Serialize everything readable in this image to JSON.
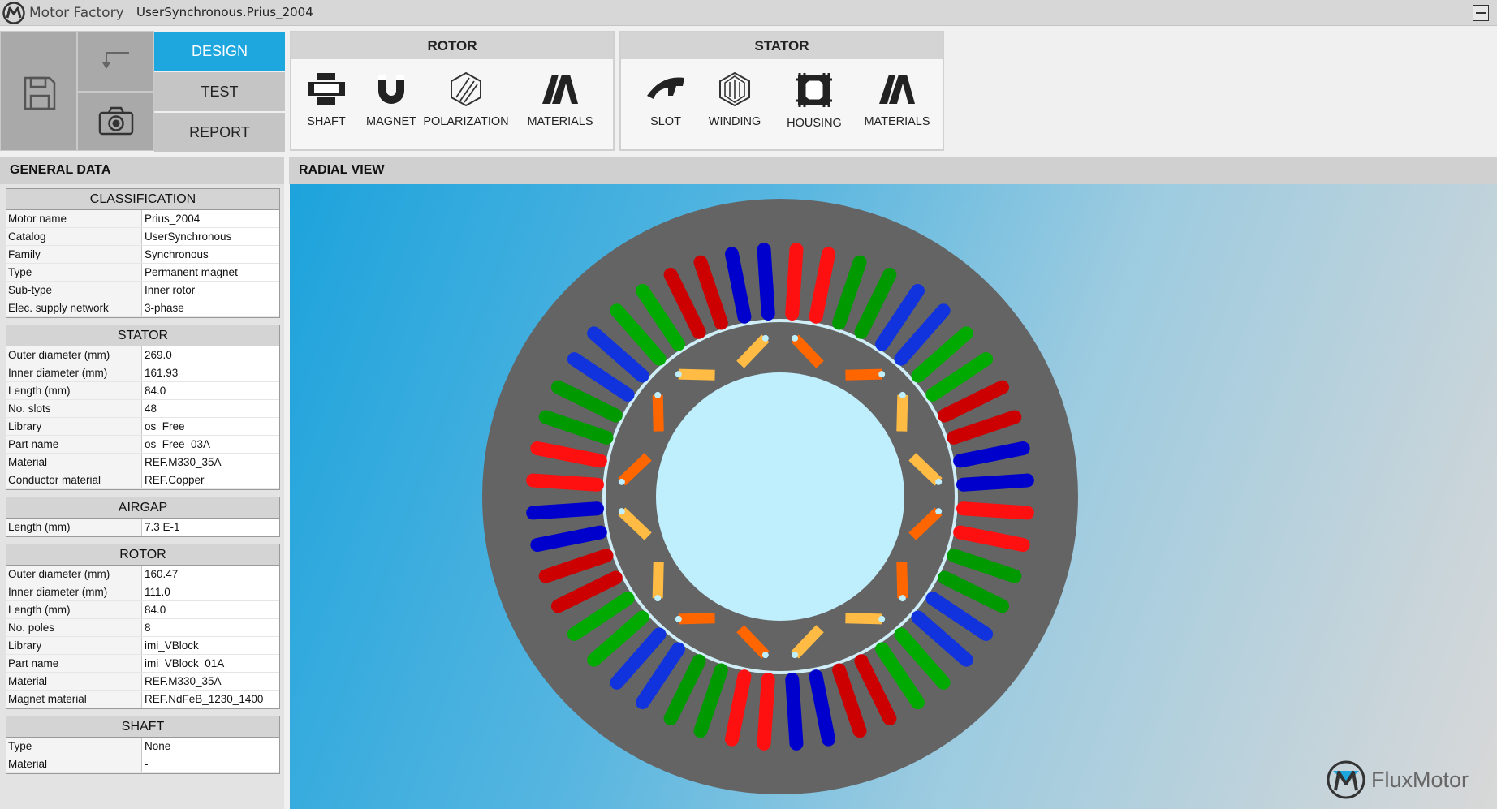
{
  "titlebar": {
    "app_name": "Motor Factory",
    "document": "UserSynchronous.Prius_2004"
  },
  "modes": {
    "design": "DESIGN",
    "test": "TEST",
    "report": "REPORT",
    "active": "DESIGN"
  },
  "rotor_panel": {
    "title": "ROTOR",
    "tools": [
      {
        "label": "SHAFT",
        "icon": "shaft-icon"
      },
      {
        "label": "MAGNET",
        "icon": "magnet-icon"
      },
      {
        "label": "POLARIZATION",
        "icon": "polarization-icon"
      },
      {
        "label": "MATERIALS",
        "icon": "materials-icon"
      }
    ]
  },
  "stator_panel": {
    "title": "STATOR",
    "tools": [
      {
        "label": "SLOT",
        "icon": "slot-icon"
      },
      {
        "label": "WINDING",
        "icon": "winding-icon"
      },
      {
        "label": "HOUSING",
        "icon": "housing-icon"
      },
      {
        "label": "MATERIALS",
        "icon": "materials-icon"
      }
    ]
  },
  "general_data": {
    "title": "GENERAL DATA",
    "classification": {
      "title": "CLASSIFICATION",
      "rows": [
        {
          "k": "Motor name",
          "v": "Prius_2004"
        },
        {
          "k": "Catalog",
          "v": "UserSynchronous"
        },
        {
          "k": "Family",
          "v": "Synchronous"
        },
        {
          "k": "Type",
          "v": "Permanent magnet"
        },
        {
          "k": "Sub-type",
          "v": "Inner rotor"
        },
        {
          "k": "Elec. supply network",
          "v": "3-phase"
        }
      ]
    },
    "stator": {
      "title": "STATOR",
      "rows": [
        {
          "k": "Outer diameter (mm)",
          "v": "269.0"
        },
        {
          "k": "Inner diameter (mm)",
          "v": "161.93"
        },
        {
          "k": "Length (mm)",
          "v": "84.0"
        },
        {
          "k": "No. slots",
          "v": "48"
        },
        {
          "k": "Library",
          "v": "os_Free"
        },
        {
          "k": "Part name",
          "v": "os_Free_03A"
        },
        {
          "k": "Material",
          "v": "REF.M330_35A"
        },
        {
          "k": "Conductor material",
          "v": "REF.Copper"
        }
      ]
    },
    "airgap": {
      "title": "AIRGAP",
      "rows": [
        {
          "k": "Length (mm)",
          "v": "7.3 E-1"
        }
      ]
    },
    "rotor": {
      "title": "ROTOR",
      "rows": [
        {
          "k": "Outer diameter (mm)",
          "v": "160.47"
        },
        {
          "k": "Inner diameter (mm)",
          "v": "111.0"
        },
        {
          "k": "Length (mm)",
          "v": "84.0"
        },
        {
          "k": "No. poles",
          "v": "8"
        },
        {
          "k": "Library",
          "v": "imi_VBlock"
        },
        {
          "k": "Part name",
          "v": "imi_VBlock_01A"
        },
        {
          "k": "Material",
          "v": "REF.M330_35A"
        },
        {
          "k": "Magnet material",
          "v": "REF.NdFeB_1230_1400"
        }
      ]
    },
    "shaft": {
      "title": "SHAFT",
      "rows": [
        {
          "k": "Type",
          "v": "None"
        },
        {
          "k": "Material",
          "v": "-"
        }
      ]
    }
  },
  "radial_view": {
    "title": "RADIAL VIEW",
    "slots": 48,
    "poles": 8,
    "phase_colors": [
      "#ff0000",
      "#00aa00",
      "#0022cc",
      "#008800",
      "#ee0000",
      "#0000aa"
    ],
    "slot_colors": [
      "#ff1010",
      "#009900",
      "#1133dd",
      "#00aa00",
      "#cc0000",
      "#0000cc"
    ],
    "magnet_colors": {
      "pole_a": "#ff6600",
      "pole_b": "#ffbb44"
    },
    "colors": {
      "iron": "#646464",
      "airgap": "#cfeef8",
      "bore": "#bfeefc"
    }
  },
  "brand": {
    "name": "FluxMotor"
  }
}
